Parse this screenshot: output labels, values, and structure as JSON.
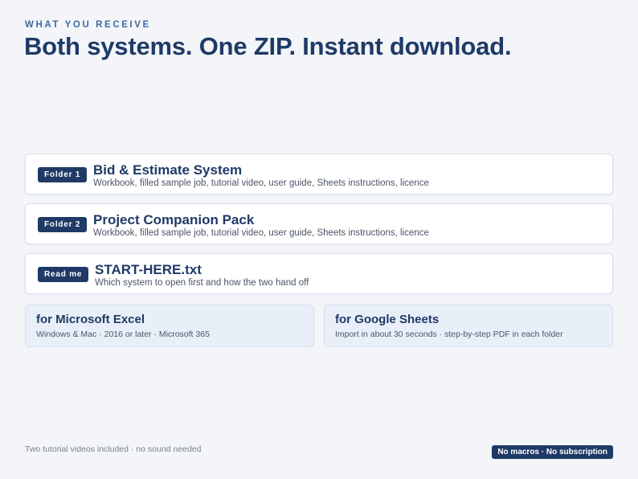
{
  "header": {
    "eyebrow": "WHAT YOU RECEIVE",
    "headline": "Both systems. One ZIP. Instant download."
  },
  "items": [
    {
      "badge": "Folder 1",
      "title": "Bid & Estimate System",
      "description": "Workbook, filled sample job, tutorial video, user guide, Sheets instructions, licence"
    },
    {
      "badge": "Folder 2",
      "title": "Project Companion Pack",
      "description": "Workbook, filled sample job, tutorial video, user guide, Sheets instructions, licence"
    },
    {
      "badge": "Read me",
      "title": "START-HERE.txt",
      "description": "Which system to open first and how the two hand off"
    }
  ],
  "systems": [
    {
      "title": "for Microsoft Excel",
      "description": "Windows & Mac · 2016 or later · Microsoft 365"
    },
    {
      "title": "for Google Sheets",
      "description": "Import in about 30 seconds · step-by-step PDF in each folder"
    }
  ],
  "footer": {
    "note": "Two tutorial videos included · no sound needed",
    "pill": "No macros · No subscription"
  },
  "colors": {
    "background": "#f3f5f9",
    "navy": "#1f3a66",
    "accent": "#3f6aa1",
    "system_panel": "#e9eff8"
  }
}
